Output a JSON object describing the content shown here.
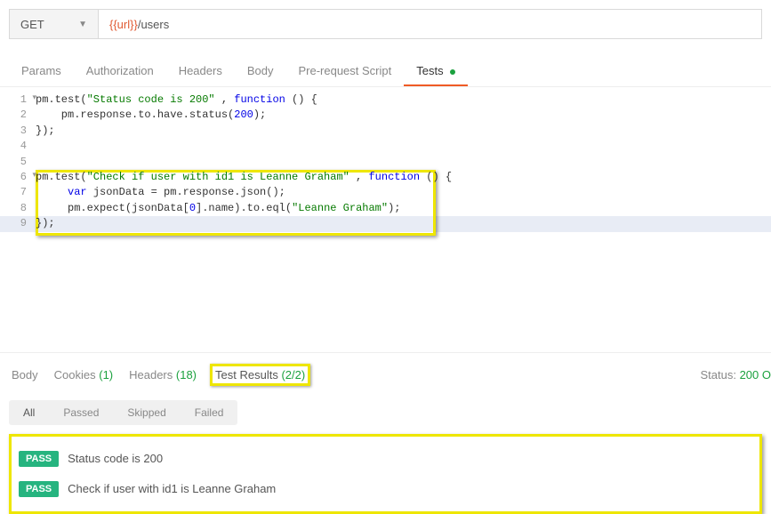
{
  "request": {
    "method": "GET",
    "url_var": "{{url}}",
    "url_path": "/users"
  },
  "tabs": {
    "params": "Params",
    "authorization": "Authorization",
    "headers": "Headers",
    "body": "Body",
    "prerequest": "Pre-request Script",
    "tests": "Tests"
  },
  "code": {
    "lines": [
      {
        "n": "1",
        "fold": true,
        "parts": [
          [
            "",
            "pm.test("
          ],
          [
            "str",
            "\"Status code is 200\""
          ],
          [
            "",
            " , "
          ],
          [
            "kw",
            "function"
          ],
          [
            "",
            " () {"
          ]
        ]
      },
      {
        "n": "2",
        "fold": false,
        "parts": [
          [
            "",
            "    pm.response.to.have.status("
          ],
          [
            "num",
            "200"
          ],
          [
            "",
            ");"
          ]
        ]
      },
      {
        "n": "3",
        "fold": false,
        "parts": [
          [
            "",
            "});"
          ]
        ]
      },
      {
        "n": "4",
        "fold": false,
        "parts": [
          [
            "",
            ""
          ]
        ]
      },
      {
        "n": "5",
        "fold": false,
        "parts": [
          [
            "",
            ""
          ]
        ]
      },
      {
        "n": "6",
        "fold": true,
        "parts": [
          [
            "",
            "pm.test("
          ],
          [
            "str",
            "\"Check if user with id1 is Leanne Graham\""
          ],
          [
            "",
            " , "
          ],
          [
            "kw",
            "function"
          ],
          [
            "",
            " () {"
          ]
        ]
      },
      {
        "n": "7",
        "fold": false,
        "parts": [
          [
            "",
            "     "
          ],
          [
            "kw",
            "var"
          ],
          [
            "",
            " jsonData = pm.response.json();"
          ]
        ]
      },
      {
        "n": "8",
        "fold": false,
        "parts": [
          [
            "",
            "     pm.expect(jsonData["
          ],
          [
            "num",
            "0"
          ],
          [
            "",
            "].name).to.eql("
          ],
          [
            "str",
            "\"Leanne Graham\""
          ],
          [
            "",
            ");"
          ]
        ]
      },
      {
        "n": "9",
        "fold": false,
        "highlight": true,
        "parts": [
          [
            "",
            "});"
          ]
        ]
      }
    ]
  },
  "response_tabs": {
    "body": "Body",
    "cookies": "Cookies",
    "cookies_count": "(1)",
    "headers": "Headers",
    "headers_count": "(18)",
    "test_results": "Test Results",
    "test_results_count": "(2/2)"
  },
  "status": {
    "label": "Status:",
    "value": "200 O"
  },
  "filter": {
    "all": "All",
    "passed": "Passed",
    "skipped": "Skipped",
    "failed": "Failed"
  },
  "results": [
    {
      "badge": "PASS",
      "label": "Status code is 200"
    },
    {
      "badge": "PASS",
      "label": "Check if user with id1 is Leanne Graham"
    }
  ]
}
